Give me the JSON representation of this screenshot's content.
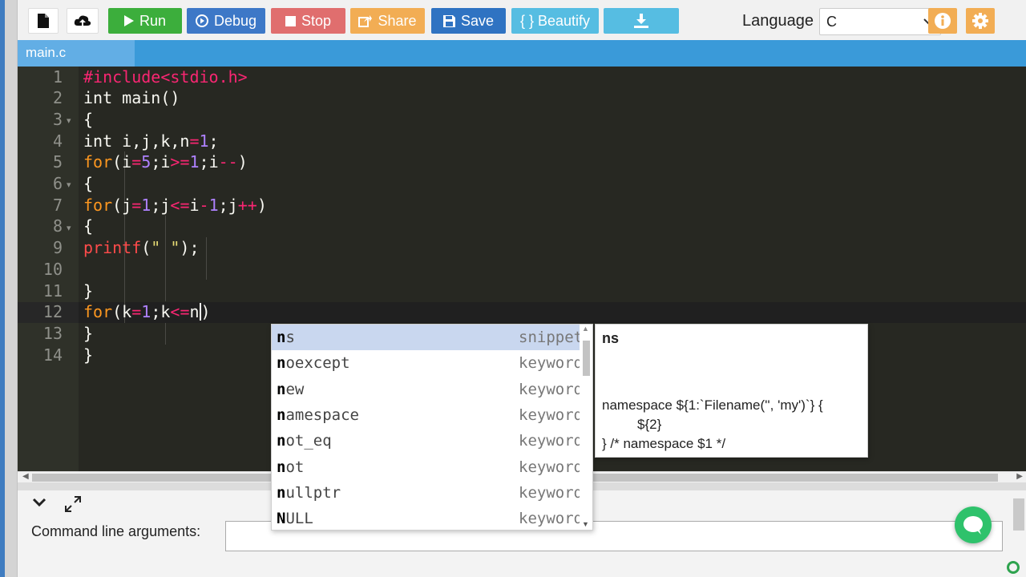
{
  "toolbar": {
    "buttons": [
      {
        "id": "new",
        "label": "",
        "icon": "file-icon"
      },
      {
        "id": "upload",
        "label": "",
        "icon": "cloud-upload-icon"
      },
      {
        "id": "run",
        "label": "Run",
        "icon": "play-icon"
      },
      {
        "id": "debug",
        "label": "Debug",
        "icon": "debug-icon"
      },
      {
        "id": "stop",
        "label": "Stop",
        "icon": "stop-icon"
      },
      {
        "id": "share",
        "label": "Share",
        "icon": "share-icon"
      },
      {
        "id": "save",
        "label": "Save",
        "icon": "save-icon"
      },
      {
        "id": "beautify",
        "label": "{ } Beautify",
        "icon": ""
      },
      {
        "id": "download",
        "label": "",
        "icon": "download-icon"
      }
    ],
    "language_label": "Language",
    "language_value": "C",
    "info_icon": "info-icon",
    "settings_icon": "gear-icon"
  },
  "tabs": [
    {
      "label": "main.c"
    }
  ],
  "editor": {
    "line_numbers": [
      "1",
      "2",
      "3",
      "4",
      "5",
      "6",
      "7",
      "8",
      "9",
      "10",
      "11",
      "12",
      "13",
      "14"
    ],
    "active_line": 12
  },
  "autocomplete": {
    "items": [
      {
        "match": "n",
        "rest": "s",
        "type": "snippet"
      },
      {
        "match": "n",
        "rest": "oexcept",
        "type": "keyword"
      },
      {
        "match": "n",
        "rest": "ew",
        "type": "keyword"
      },
      {
        "match": "n",
        "rest": "amespace",
        "type": "keyword"
      },
      {
        "match": "n",
        "rest": "ot_eq",
        "type": "keyword"
      },
      {
        "match": "n",
        "rest": "ot",
        "type": "keyword"
      },
      {
        "match": "n",
        "rest": "ullptr",
        "type": "keyword"
      },
      {
        "match": "N",
        "rest": "ULL",
        "type": "keyword"
      }
    ],
    "selected_index": 0
  },
  "doc_tooltip": {
    "title": "ns",
    "line1": "namespace ${1:`Filename('', 'my')`} {",
    "line2": "${2}",
    "line3": "} /* namespace $1 */"
  },
  "bottom": {
    "command_line_label": "Command line arguments:",
    "command_line_value": ""
  }
}
